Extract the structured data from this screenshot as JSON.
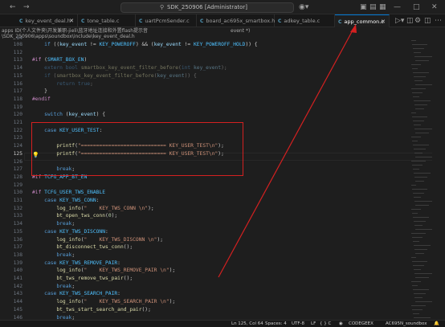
{
  "titlebar": {
    "search_text": "SDK_250906 [Administrator]",
    "left_icons": [
      "back-arrow-icon",
      "forward-arrow-icon"
    ],
    "right_icons": [
      "copilot-icon",
      "layout-panel-icon",
      "layout-sidebar-icon",
      "layout-custom-icon",
      "minimize-icon",
      "maximize-icon",
      "close-icon"
    ]
  },
  "tabs": [
    {
      "label": "key_event_deal.h",
      "icon": "C"
    },
    {
      "label": "tone_table.c",
      "icon": "C"
    },
    {
      "label": "uartPcmSender.c",
      "icon": "C"
    },
    {
      "label": "board_ac695x_smartbox.h",
      "icon": "C"
    },
    {
      "label": "adkey_table.c",
      "icon": "C"
    },
    {
      "label": "app_common.c",
      "icon": "C",
      "active": true
    }
  ],
  "breadcrumbs": {
    "line1": "apps  ID(个人文件夹\\开发兼职-jieli\\蓝牙地址连接和外置flash提示音",
    "line2": "\\SDK_250906\\apps\\soundbox\\include\\key_event_deal.h",
    "line3": "event *)",
    "gutter_top": "84"
  },
  "code_lines": [
    {
      "n": "108",
      "t": "    if ((key_event != KEY_POWEROFF) && (key_event != KEY_POWEROFF_HOLD)) {"
    },
    {
      "n": "112",
      "t": ""
    },
    {
      "n": "113",
      "t": "#if (SMART_BOX_EN)"
    },
    {
      "n": "114",
      "t": "    extern bool smartbox_key_event_filter_before(int key_event);"
    },
    {
      "n": "115",
      "t": "    if (smartbox_key_event_filter_before(key_event)) {"
    },
    {
      "n": "116",
      "t": "        return true;"
    },
    {
      "n": "117",
      "t": "    }"
    },
    {
      "n": "118",
      "t": "#endif"
    },
    {
      "n": "119",
      "t": ""
    },
    {
      "n": "120",
      "t": "    switch (key_event) {"
    },
    {
      "n": "121",
      "t": ""
    },
    {
      "n": "122",
      "t": "    case KEY_USER_TEST:"
    },
    {
      "n": "123",
      "t": ""
    },
    {
      "n": "124",
      "t": "        printf(\"============================ KEY_USER_TEST\\n\");"
    },
    {
      "n": "125",
      "t": "        printf(\"============================ KEY_USER_TEST\\n\");"
    },
    {
      "n": "126",
      "t": ""
    },
    {
      "n": "127",
      "t": "        break;"
    },
    {
      "n": "128",
      "t": "#if TCFG_APP_BT_EN"
    },
    {
      "n": "129",
      "t": ""
    },
    {
      "n": "130",
      "t": "#if TCFG_USER_TWS_ENABLE"
    },
    {
      "n": "131",
      "t": "    case KEY_TWS_CONN:"
    },
    {
      "n": "132",
      "t": "        log_info(\"    KEY_TWS_CONN \\n\");"
    },
    {
      "n": "133",
      "t": "        bt_open_tws_conn(0);"
    },
    {
      "n": "134",
      "t": "        break;"
    },
    {
      "n": "135",
      "t": "    case KEY_TWS_DISCONN:"
    },
    {
      "n": "136",
      "t": "        log_info(\"    KEY_TWS_DISCONN \\n\");"
    },
    {
      "n": "137",
      "t": "        bt_disconnect_tws_conn();"
    },
    {
      "n": "138",
      "t": "        break;"
    },
    {
      "n": "139",
      "t": "    case KEY_TWS_REMOVE_PAIR:"
    },
    {
      "n": "140",
      "t": "        log_info(\"    KEY_TWS_REMOVE_PAIR \\n\");"
    },
    {
      "n": "141",
      "t": "        bt_tws_remove_tws_pair();"
    },
    {
      "n": "142",
      "t": "        break;"
    },
    {
      "n": "143",
      "t": "    case KEY_TWS_SEARCH_PAIR:"
    },
    {
      "n": "144",
      "t": "        log_info(\"    KEY_TWS_SEARCH_PAIR \\n\");"
    },
    {
      "n": "145",
      "t": "        bt_tws_start_search_and_pair();"
    },
    {
      "n": "146",
      "t": "        break;"
    }
  ],
  "status": {
    "position": "Ln 125, Col 64",
    "spaces": "Spaces: 4",
    "encoding": "UTF-8",
    "eol": "LF",
    "lang": "{ } C",
    "codegeex": "CODEGEEX",
    "target": "AC695N_soundbox"
  },
  "colors": {
    "accent": "#0078d4",
    "annotation": "#d42020"
  }
}
